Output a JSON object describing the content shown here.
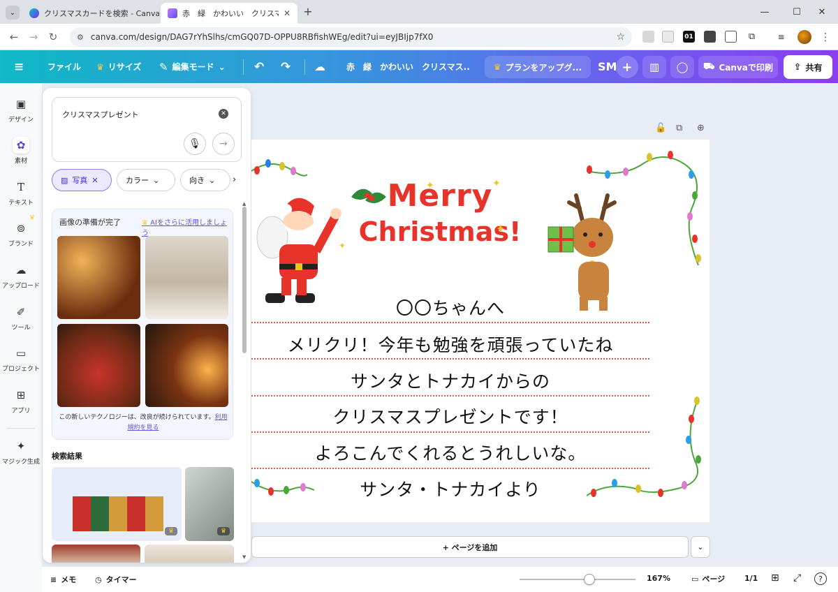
{
  "browser": {
    "tabs": [
      {
        "label": "クリスマスカードを検索 - Canva"
      },
      {
        "label": "赤　緑　かわいい　クリスマスカー"
      }
    ],
    "url": "canva.com/design/DAG7rYhSlhs/cmGQ07D-OPPU8RBfishWEg/edit?ui=eyJBIjp7fX0",
    "ext_01": "01"
  },
  "toolbar": {
    "file": "ファイル",
    "resize": "リサイズ",
    "edit_mode": "編集モード",
    "doc_title": "赤　緑　かわいい　クリスマス...",
    "upgrade": "プランをアップグ...",
    "avatar": "SM",
    "print": "Canvaで印刷",
    "share": "共有"
  },
  "rail": {
    "items": [
      {
        "label": "デザイン"
      },
      {
        "label": "素材"
      },
      {
        "label": "テキスト"
      },
      {
        "label": "ブランド"
      },
      {
        "label": "アップロード"
      },
      {
        "label": "ツール"
      },
      {
        "label": "プロジェクト"
      },
      {
        "label": "アプリ"
      },
      {
        "label": "マジック生成"
      }
    ]
  },
  "panel": {
    "search_value": "クリスマスプレゼント",
    "chips": {
      "photo": "写真",
      "color": "カラー",
      "orientation": "向き"
    },
    "ai_card": {
      "title": "画像の準備が完了",
      "link": "AIをさらに活用しましょう",
      "note": "この新しいテクノロジーは、改良が続けられています。",
      "terms": "利用規約を見る"
    },
    "results_heading": "検索結果"
  },
  "canvas": {
    "merry": "Merry",
    "christmas": "Christmas!",
    "lines": [
      "〇〇ちゃんへ",
      "メリクリ！今年も勉強を頑張っていたね",
      "サンタとトナカイからの",
      "クリスマスプレゼントです！",
      "よろこんでくれるとうれしいな。",
      "サンタ・トナカイより"
    ],
    "add_page": "+ ページを追加"
  },
  "footer": {
    "memo": "メモ",
    "timer": "タイマー",
    "zoom": "167%",
    "zoom_level": 0.6,
    "pages": "ページ",
    "page_count": "1/1"
  },
  "colors": {
    "accent": "#7d2ae8",
    "teal": "#00c4cc",
    "merry_red": "#e8332a",
    "dotted": "#e05a3a"
  }
}
